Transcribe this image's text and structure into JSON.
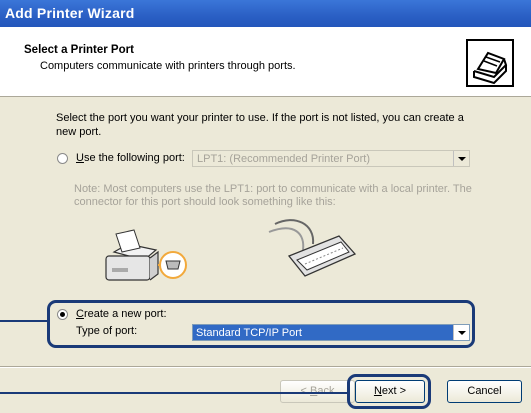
{
  "window": {
    "title": "Add Printer Wizard"
  },
  "header": {
    "title": "Select a Printer Port",
    "subtitle": "Computers communicate with printers through ports."
  },
  "intro": "Select the port you want your printer to use.  If the port is not listed, you can create a new port.",
  "use_port": {
    "label_prefix": "U",
    "label_rest": "se the following port:",
    "value": "LPT1: (Recommended Printer Port)",
    "selected": false
  },
  "note": "Note: Most computers use the LPT1: port to communicate with a local printer. The connector for this port should look something like this:",
  "create_port": {
    "label_prefix": "C",
    "label_rest": "reate a new port:",
    "selected": true,
    "type_label": "Type of port:",
    "type_value": "Standard TCP/IP Port"
  },
  "buttons": {
    "back_prefix": "< ",
    "back_underline": "B",
    "back_rest": "ack",
    "next_underline": "N",
    "next_rest": "ext >",
    "cancel": "Cancel"
  },
  "colors": {
    "highlight": "#1a3a78",
    "titlebar": "#2a5fc4",
    "selection": "#316ac5"
  },
  "icons": [
    "printer-icon",
    "printer-illustration-icon",
    "parallel-cable-icon",
    "parallel-port-icon"
  ]
}
